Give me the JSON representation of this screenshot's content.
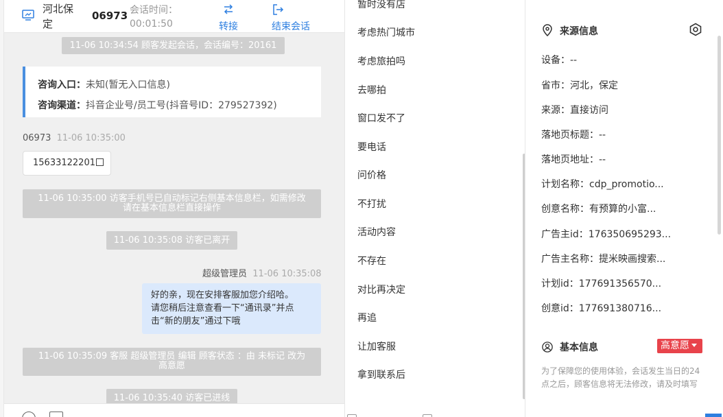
{
  "header": {
    "location": "河北保定",
    "session_id": "06973",
    "session_time_label": "会话时间：",
    "session_time_value": "00:01:50",
    "transfer_label": "转接",
    "end_label": "结束会话"
  },
  "chat": {
    "sys_start": "11-06 10:34:54 顾客发起会话，会话编号：20161",
    "entry_label": "咨询入口：",
    "entry_value": "未知(暂无入口信息)",
    "channel_label": "咨询渠道：",
    "channel_value": "抖音企业号/员工号(抖音号ID：279527392)",
    "visitor_name": "06973",
    "visitor_time": "11-06 10:35:00",
    "phone": "15633122201",
    "sys_phone_line1": "11-06 10:35:00 访客手机号已自动标记右侧基本信息栏，如需修改",
    "sys_phone_line2": "请在基本信息栏直接操作",
    "sys_leave": "11-06 10:35:08 访客已离开",
    "agent_name": "超级管理员",
    "agent_time": "11-06 10:35:08",
    "agent_msg_line1": "好的亲，现在安排客服加您介绍哈。",
    "agent_msg_line2": "请您稍后注意查看一下“通讯录”并点",
    "agent_msg_line3": "击“新的朋友”通过下哦",
    "sys_status_line1": "11-06 10:35:09 客服 超级管理员 编辑 顾客状态 ：由 未标记 改为",
    "sys_status_line2": "高意愿",
    "sys_enter": "11-06 10:35:40 访客已进线"
  },
  "quick_replies": [
    "暂时没有店",
    "考虑热门城市",
    "考虑旅拍吗",
    "去哪拍",
    "窗口发不了",
    "要电话",
    "问价格",
    "不打扰",
    "活动内容",
    "不存在",
    "对比再决定",
    "再追",
    "让加客服",
    "拿到联系后"
  ],
  "source_info": {
    "title": "来源信息",
    "fields": [
      "设备：--",
      "省市：河北，保定",
      "来源：直接访问",
      "落地页标题：--",
      "落地页地址：--",
      "计划名称：cdp_promotio...",
      "创意名称：有预算的小富...",
      "广告主id：176350695293...",
      "广告主名称：提米映画搜索...",
      "计划id：177691356570...",
      "创意id：177691380716..."
    ]
  },
  "basic_info": {
    "title": "基本信息",
    "intent": "高意愿",
    "notice": "为了保障您的使用体验，会话发生当日的24点之后，顾客信息将无法修改，请及时填写"
  },
  "icons": {
    "monitor": "monitor-icon",
    "transfer": "transfer-icon",
    "exit": "exit-icon",
    "location": "location-pin-icon",
    "settings": "hexagon-settings-icon",
    "user": "user-circle-icon",
    "copy": "copy-icon"
  },
  "colors": {
    "accent": "#2e7fe0",
    "badge": "#e8434b",
    "agent_bubble": "#dbe9fc",
    "system_msg": "#cfcfcf"
  }
}
